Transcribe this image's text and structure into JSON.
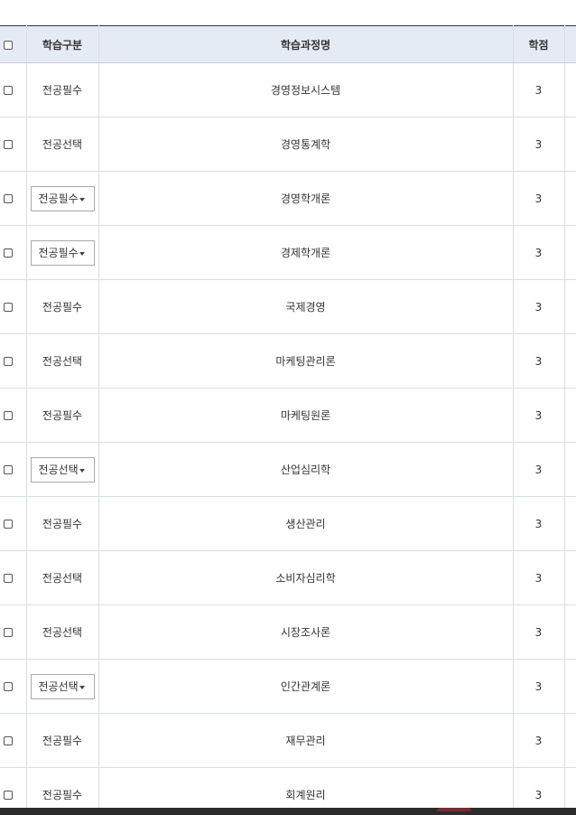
{
  "table": {
    "headers": {
      "category": "학습구분",
      "course_name": "학습과정명",
      "credits": "학점"
    },
    "rows": [
      {
        "category": "전공필수",
        "course_name": "경영정보시스템",
        "credits": "3",
        "category_is_dropdown": false
      },
      {
        "category": "전공선택",
        "course_name": "경영통계학",
        "credits": "3",
        "category_is_dropdown": false
      },
      {
        "category": "전공필수",
        "course_name": "경영학개론",
        "credits": "3",
        "category_is_dropdown": true
      },
      {
        "category": "전공필수",
        "course_name": "경제학개론",
        "credits": "3",
        "category_is_dropdown": true
      },
      {
        "category": "전공필수",
        "course_name": "국제경영",
        "credits": "3",
        "category_is_dropdown": false
      },
      {
        "category": "전공선택",
        "course_name": "마케팅관리론",
        "credits": "3",
        "category_is_dropdown": false
      },
      {
        "category": "전공필수",
        "course_name": "마케팅원론",
        "credits": "3",
        "category_is_dropdown": false
      },
      {
        "category": "전공선택",
        "course_name": "산업심리학",
        "credits": "3",
        "category_is_dropdown": true
      },
      {
        "category": "전공필수",
        "course_name": "생산관리",
        "credits": "3",
        "category_is_dropdown": false
      },
      {
        "category": "전공선택",
        "course_name": "소비자심리학",
        "credits": "3",
        "category_is_dropdown": false
      },
      {
        "category": "전공선택",
        "course_name": "시장조사론",
        "credits": "3",
        "category_is_dropdown": false
      },
      {
        "category": "전공선택",
        "course_name": "인간관계론",
        "credits": "3",
        "category_is_dropdown": true
      },
      {
        "category": "전공필수",
        "course_name": "재무관리",
        "credits": "3",
        "category_is_dropdown": false
      },
      {
        "category": "전공필수",
        "course_name": "회계원리",
        "credits": "3",
        "category_is_dropdown": false
      }
    ]
  },
  "colors": {
    "header_background": "#e5ebf5",
    "header_top_border": "#2c3a4f",
    "cell_border": "#d9dee5"
  }
}
